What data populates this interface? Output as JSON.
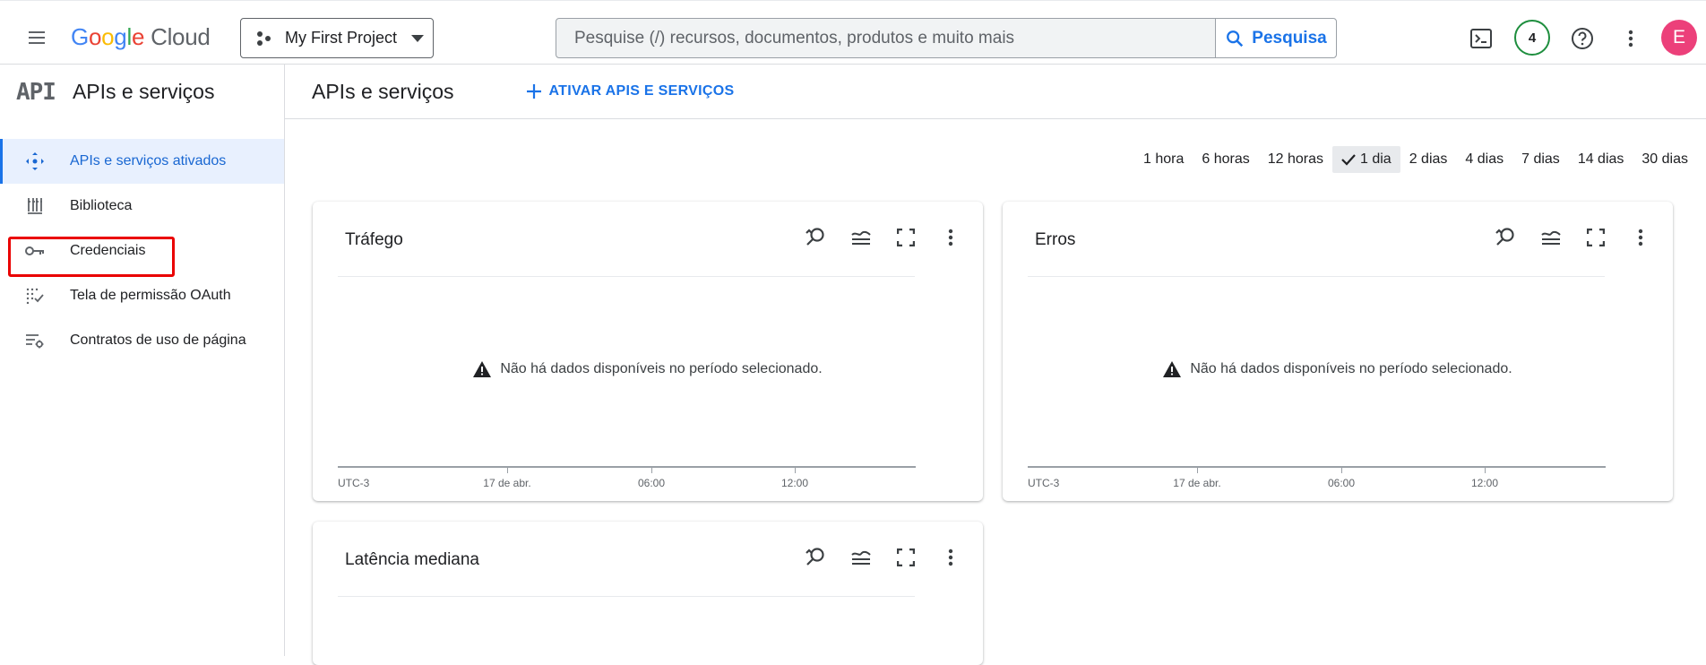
{
  "topbar": {
    "logo_google": "Google",
    "logo_cloud": "Cloud",
    "project": "My First Project",
    "search_placeholder": "Pesquise (/) recursos, documentos, produtos e muito mais",
    "search_button": "Pesquisa",
    "notification_count": "4",
    "avatar_letter": "E",
    "avatar_color": "#ec407a"
  },
  "sidebar": {
    "logo_text": "API",
    "title": "APIs e serviços",
    "items": [
      {
        "label": "APIs e serviços ativados",
        "icon": "diamond-arrows-icon",
        "active": true
      },
      {
        "label": "Biblioteca",
        "icon": "library-icon",
        "active": false
      },
      {
        "label": "Credenciais",
        "icon": "key-icon",
        "active": false
      },
      {
        "label": "Tela de permissão OAuth",
        "icon": "oauth-dots-icon",
        "active": false
      },
      {
        "label": "Contratos de uso de página",
        "icon": "settings-list-icon",
        "active": false
      }
    ]
  },
  "main": {
    "title": "APIs e serviços",
    "enable_button": "ATIVAR APIS E SERVIÇOS",
    "time_options": [
      "1 hora",
      "6 horas",
      "12 horas",
      "1 dia",
      "2 dias",
      "4 dias",
      "7 dias",
      "14 dias",
      "30 dias"
    ],
    "selected_time": "1 dia",
    "cards": [
      {
        "title": "Tráfego",
        "empty_message": "Não há dados disponíveis no período selecionado.",
        "x_ticks": [
          "UTC-3",
          "17 de abr.",
          "06:00",
          "12:00"
        ]
      },
      {
        "title": "Erros",
        "empty_message": "Não há dados disponíveis no período selecionado.",
        "x_ticks": [
          "UTC-3",
          "17 de abr.",
          "06:00",
          "12:00"
        ]
      },
      {
        "title": "Latência mediana"
      }
    ]
  },
  "colors": {
    "accent": "#1a73e8",
    "highlight": "#ea0000",
    "status_green": "#1e8e3e"
  }
}
